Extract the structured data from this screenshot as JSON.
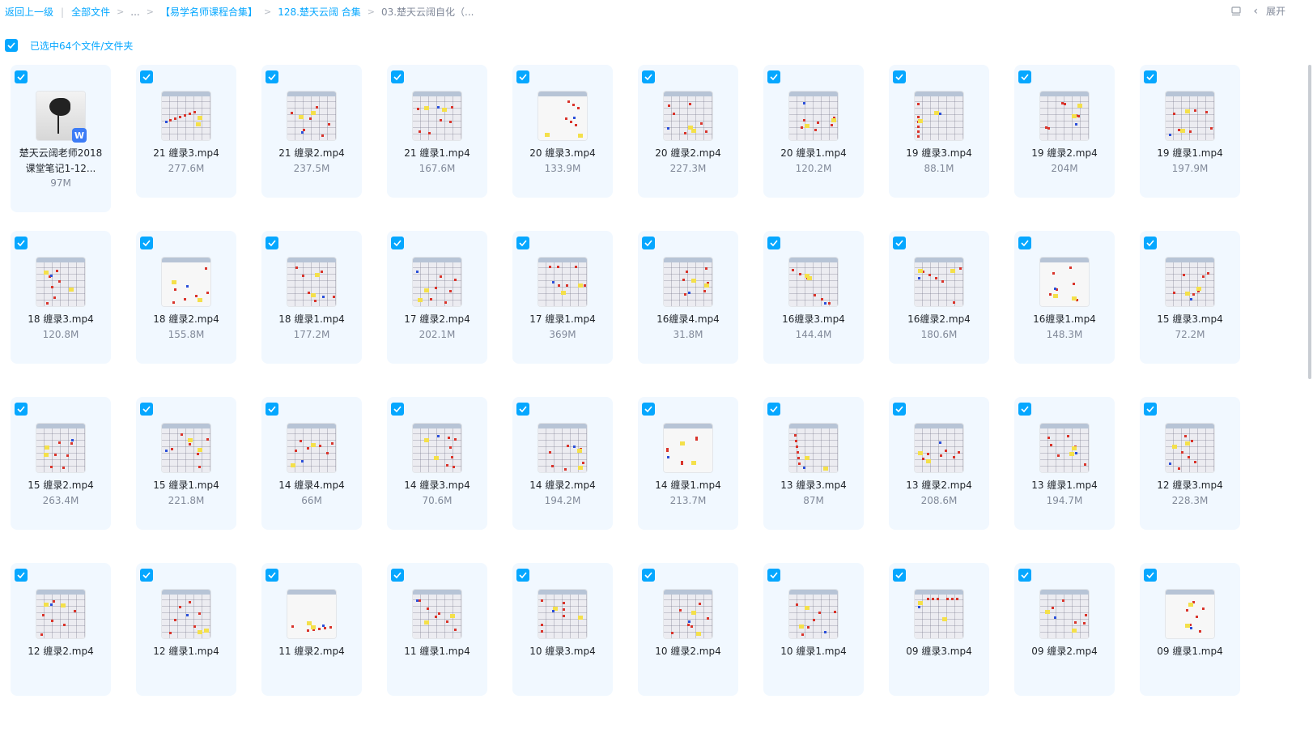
{
  "breadcrumb": {
    "back": "返回上一级",
    "all_files": "全部文件",
    "ellipsis": "...",
    "path": [
      "【易学名师课程合集】",
      "128.楚天云阔 合集"
    ],
    "current": "03.楚天云阔自化（..."
  },
  "toolbar": {
    "expand_label": "展开"
  },
  "selection": {
    "text": "已选中64个文件/文件夹"
  },
  "colors": {
    "accent": "#06a7ff",
    "tile_bg": "#f1f8ff",
    "muted": "#818999"
  },
  "files": [
    {
      "name": "楚天云阔老师2018课堂笔记1-12...",
      "size": "97M",
      "type": "doc"
    },
    {
      "name": "21 缠录3.mp4",
      "size": "277.6M",
      "type": "video"
    },
    {
      "name": "21 缠录2.mp4",
      "size": "237.5M",
      "type": "video"
    },
    {
      "name": "21 缠录1.mp4",
      "size": "167.6M",
      "type": "video"
    },
    {
      "name": "20 缠录3.mp4",
      "size": "133.9M",
      "type": "video"
    },
    {
      "name": "20 缠录2.mp4",
      "size": "227.3M",
      "type": "video"
    },
    {
      "name": "20 缠录1.mp4",
      "size": "120.2M",
      "type": "video"
    },
    {
      "name": "19 缠录3.mp4",
      "size": "88.1M",
      "type": "video"
    },
    {
      "name": "19 缠录2.mp4",
      "size": "204M",
      "type": "video"
    },
    {
      "name": "19 缠录1.mp4",
      "size": "197.9M",
      "type": "video"
    },
    {
      "name": "18 缠录3.mp4",
      "size": "120.8M",
      "type": "video"
    },
    {
      "name": "18 缠录2.mp4",
      "size": "155.8M",
      "type": "video"
    },
    {
      "name": "18 缠录1.mp4",
      "size": "177.2M",
      "type": "video"
    },
    {
      "name": "17 缠录2.mp4",
      "size": "202.1M",
      "type": "video"
    },
    {
      "name": "17 缠录1.mp4",
      "size": "369M",
      "type": "video"
    },
    {
      "name": "16缠录4.mp4",
      "size": "31.8M",
      "type": "video"
    },
    {
      "name": "16缠录3.mp4",
      "size": "144.4M",
      "type": "video"
    },
    {
      "name": "16缠录2.mp4",
      "size": "180.6M",
      "type": "video"
    },
    {
      "name": "16缠录1.mp4",
      "size": "148.3M",
      "type": "video"
    },
    {
      "name": "15 缠录3.mp4",
      "size": "72.2M",
      "type": "video"
    },
    {
      "name": "15 缠录2.mp4",
      "size": "263.4M",
      "type": "video"
    },
    {
      "name": "15 缠录1.mp4",
      "size": "221.8M",
      "type": "video"
    },
    {
      "name": "14 缠录4.mp4",
      "size": "66M",
      "type": "video"
    },
    {
      "name": "14 缠录3.mp4",
      "size": "70.6M",
      "type": "video"
    },
    {
      "name": "14 缠录2.mp4",
      "size": "194.2M",
      "type": "video"
    },
    {
      "name": "14 缠录1.mp4",
      "size": "213.7M",
      "type": "video"
    },
    {
      "name": "13 缠录3.mp4",
      "size": "87M",
      "type": "video"
    },
    {
      "name": "13 缠录2.mp4",
      "size": "208.6M",
      "type": "video"
    },
    {
      "name": "13 缠录1.mp4",
      "size": "194.7M",
      "type": "video"
    },
    {
      "name": "12 缠录3.mp4",
      "size": "228.3M",
      "type": "video"
    },
    {
      "name": "12 缠录2.mp4",
      "size": "",
      "type": "video"
    },
    {
      "name": "12 缠录1.mp4",
      "size": "",
      "type": "video"
    },
    {
      "name": "11 缠录2.mp4",
      "size": "",
      "type": "video"
    },
    {
      "name": "11 缠录1.mp4",
      "size": "",
      "type": "video"
    },
    {
      "name": "10 缠录3.mp4",
      "size": "",
      "type": "video"
    },
    {
      "name": "10 缠录2.mp4",
      "size": "",
      "type": "video"
    },
    {
      "name": "10 缠录1.mp4",
      "size": "",
      "type": "video"
    },
    {
      "name": "09 缠录3.mp4",
      "size": "",
      "type": "video"
    },
    {
      "name": "09 缠录2.mp4",
      "size": "",
      "type": "video"
    },
    {
      "name": "09 缠录1.mp4",
      "size": "",
      "type": "video"
    }
  ]
}
